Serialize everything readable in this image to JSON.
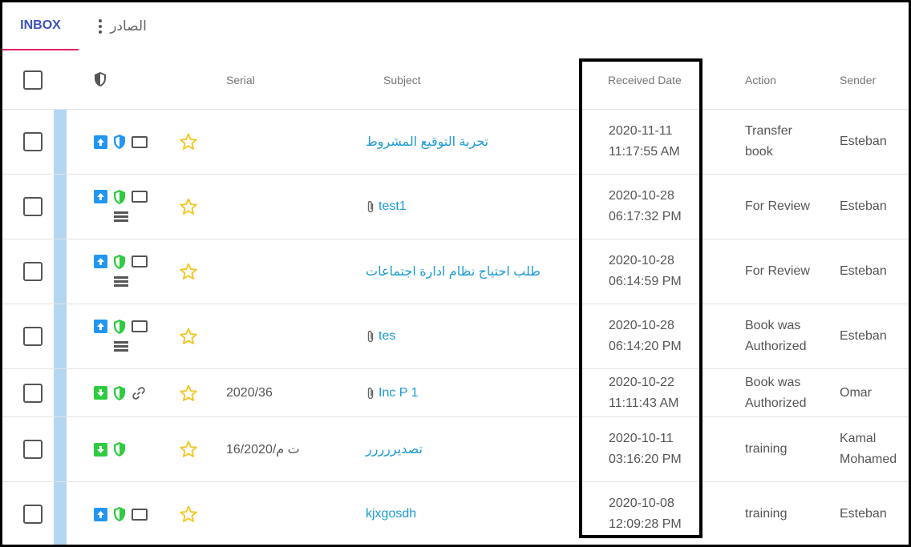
{
  "tabs": {
    "inbox": "INBOX",
    "outbox": "الصادر"
  },
  "columns": {
    "serial": "Serial",
    "subject": "Subject",
    "received_date": "Received Date",
    "action": "Action",
    "sender": "Sender"
  },
  "colors": {
    "accent": "#3f51b5",
    "tab_underline": "#e91e63",
    "link": "#1a9bd7",
    "stripe": "#b3d7f0",
    "incoming_blue": "#2196f3",
    "outgoing_green": "#2ecc40",
    "star": "#f5c518"
  },
  "rows": [
    {
      "direction": "up",
      "shield": "blue",
      "third_icon": "monitor",
      "lines_icon": false,
      "attachment": false,
      "serial": "",
      "subject": "تجربة التوقيع المشروط",
      "date": "2020-11-11",
      "time": "11:17:55 AM",
      "action_l1": "Transfer",
      "action_l2": "book",
      "sender_l1": "Esteban",
      "sender_l2": ""
    },
    {
      "direction": "up",
      "shield": "green",
      "third_icon": "monitor",
      "lines_icon": true,
      "attachment": true,
      "serial": "",
      "subject": "test1",
      "date": "2020-10-28",
      "time": "06:17:32 PM",
      "action_l1": "For Review",
      "action_l2": "",
      "sender_l1": "Esteban",
      "sender_l2": ""
    },
    {
      "direction": "up",
      "shield": "green",
      "third_icon": "monitor",
      "lines_icon": true,
      "attachment": false,
      "serial": "",
      "subject": "طلب احتياج نظام ادارة اجتماعات",
      "date": "2020-10-28",
      "time": "06:14:59 PM",
      "action_l1": "For Review",
      "action_l2": "",
      "sender_l1": "Esteban",
      "sender_l2": ""
    },
    {
      "direction": "up",
      "shield": "green",
      "third_icon": "monitor",
      "lines_icon": true,
      "attachment": true,
      "serial": "",
      "subject": "tes",
      "date": "2020-10-28",
      "time": "06:14:20 PM",
      "action_l1": "Book was",
      "action_l2": "Authorized",
      "sender_l1": "Esteban",
      "sender_l2": ""
    },
    {
      "direction": "down",
      "shield": "green",
      "third_icon": "link",
      "lines_icon": false,
      "attachment": true,
      "serial": "2020/36",
      "subject": "Inc P 1",
      "date": "2020-10-22",
      "time": "11:11:43 AM",
      "action_l1": "Book was",
      "action_l2": "Authorized",
      "sender_l1": "Omar",
      "sender_l2": ""
    },
    {
      "direction": "down",
      "shield": "green",
      "third_icon": "none",
      "lines_icon": false,
      "attachment": false,
      "serial": "ت م/16/2020",
      "subject": "تصديررررر",
      "date": "2020-10-11",
      "time": "03:16:20 PM",
      "action_l1": "training",
      "action_l2": "",
      "sender_l1": "Kamal",
      "sender_l2": "Mohamed"
    },
    {
      "direction": "up",
      "shield": "green",
      "third_icon": "monitor",
      "lines_icon": false,
      "attachment": false,
      "serial": "",
      "subject": "kjxgosdh",
      "date": "2020-10-08",
      "time": "12:09:28 PM",
      "action_l1": "training",
      "action_l2": "",
      "sender_l1": "Esteban",
      "sender_l2": ""
    }
  ]
}
